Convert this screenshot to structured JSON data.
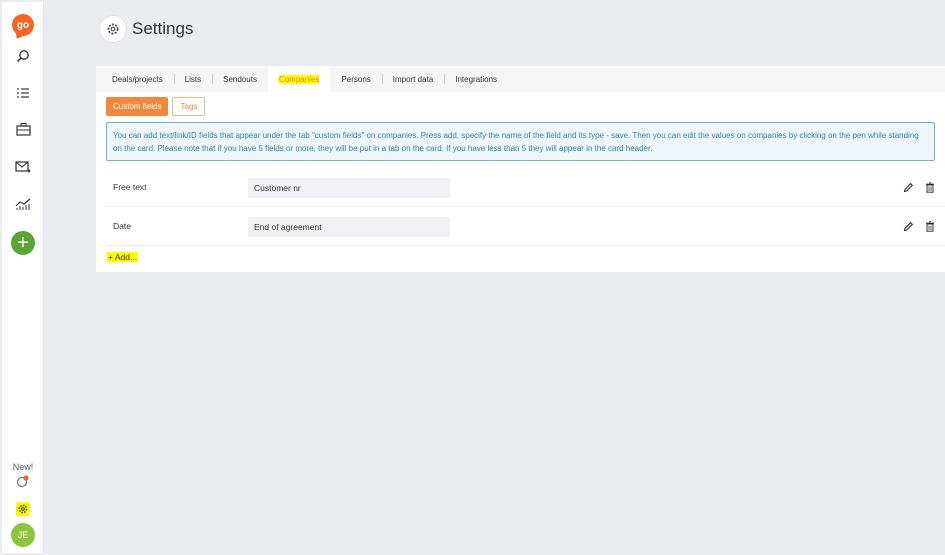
{
  "sidebar": {
    "logo_text": "go",
    "items": [
      {
        "name": "search-icon"
      },
      {
        "name": "list-icon"
      },
      {
        "name": "briefcase-icon"
      },
      {
        "name": "mail-icon"
      },
      {
        "name": "chart-icon"
      }
    ],
    "new_label": "New!",
    "avatar_initials": "JE",
    "accent_color": "#f26522",
    "add_color": "#5aa533"
  },
  "header": {
    "title": "Settings"
  },
  "tabs": [
    {
      "label": "Deals/projects",
      "active": false
    },
    {
      "label": "Lists",
      "active": false
    },
    {
      "label": "Sendouts",
      "active": false
    },
    {
      "label": "Companies",
      "active": true
    },
    {
      "label": "Persons",
      "active": false
    },
    {
      "label": "Import data",
      "active": false
    },
    {
      "label": "Integrations",
      "active": false
    }
  ],
  "buttons": {
    "custom_fields": "Custom fields",
    "tags": "Tags"
  },
  "info_text": "You can add text/link/ID fields that appear under the tab \"custom fields\" on companies. Press add, specify the name of the field and its type - save. Then you can edit the values on companies by clicking on the pen while standing on the card. Please note that if you have 5 fields or more, they will be put in a tab on the card. If you have less than 5 they will appear in the card header.",
  "fields": [
    {
      "type": "Free text",
      "name": "Customer nr"
    },
    {
      "type": "Date",
      "name": "End of agreement"
    }
  ],
  "add_label": "+ Add..."
}
